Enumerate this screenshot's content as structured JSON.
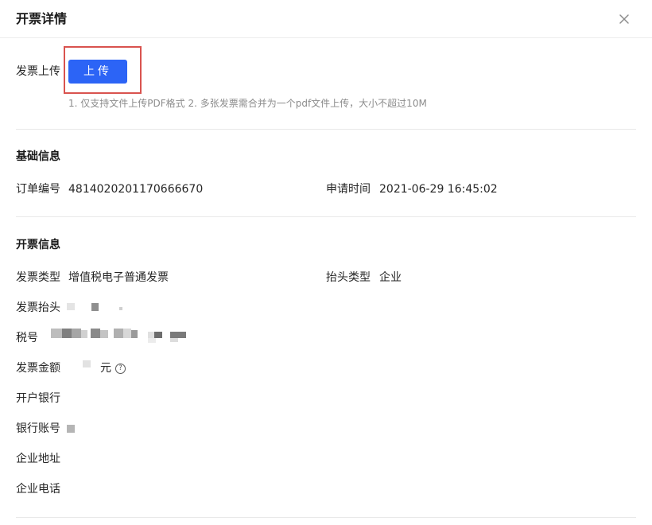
{
  "dialog": {
    "title": "开票详情"
  },
  "upload": {
    "label": "发票上传",
    "button_label": "上传",
    "hint": "1. 仅支持文件上传PDF格式 2. 多张发票需合并为一个pdf文件上传，大小不超过10M"
  },
  "basic_info": {
    "section_title": "基础信息",
    "order_no_label": "订单编号",
    "order_no_value": "4814020201170666670",
    "apply_time_label": "申请时间",
    "apply_time_value": "2021-06-29 16:45:02"
  },
  "invoice_info": {
    "section_title": "开票信息",
    "type_label": "发票类型",
    "type_value": "增值税电子普通发票",
    "header_type_label": "抬头类型",
    "header_type_value": "企业",
    "header_label": "发票抬头",
    "tax_no_label": "税号",
    "amount_label": "发票金额",
    "amount_unit": "元",
    "bank_label": "开户银行",
    "account_label": "银行账号",
    "address_label": "企业地址",
    "phone_label": "企业电话"
  },
  "colors": {
    "primary": "#2c64f6",
    "highlight_frame": "#d9534f",
    "hint_text": "#8c8c8c",
    "divider": "#e9e9e9"
  },
  "icons": {
    "close": "close-icon",
    "help": "question-circle-icon"
  }
}
